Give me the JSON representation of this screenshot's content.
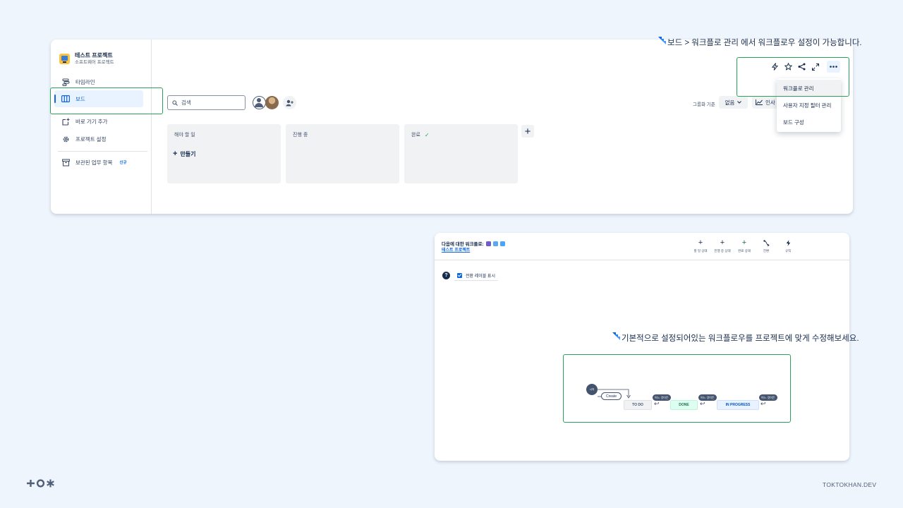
{
  "project": {
    "name": "테스트 프로젝트",
    "type": "소프트웨어 프로젝트"
  },
  "sidebar": {
    "items": [
      {
        "label": "타임라인",
        "icon": "timeline-icon"
      },
      {
        "label": "보드",
        "icon": "board-icon"
      },
      {
        "label": "바로 가기 추가",
        "icon": "add-shortcut-icon"
      },
      {
        "label": "프로젝트 설정",
        "icon": "gear-icon"
      },
      {
        "label": "보관된 업무 항목",
        "icon": "archive-icon",
        "badge": "신규"
      }
    ]
  },
  "board": {
    "search_placeholder": "검색",
    "group_by_label": "그룹화 기준",
    "group_by_value": "없음",
    "insights_label": "인사",
    "columns": [
      {
        "title": "해야 할 일",
        "create_label": "만들기"
      },
      {
        "title": "진행 중"
      },
      {
        "title": "완료",
        "done_check": "✓"
      }
    ]
  },
  "more_menu": {
    "items": [
      "워크플로 관리",
      "사용자 지정 필터 관리",
      "보드 구성"
    ]
  },
  "annotations": {
    "top": "보드 > 워크플로 관리 에서 워크플로우 설정이 가능합니다.",
    "bottom": "기본적으로 설정되어있는 워크플로우를 프로젝트에 맞게 수정해보세요."
  },
  "workflow": {
    "title": "다음에 대한 워크플로:",
    "project_link": "테스트 프로젝트",
    "tools": [
      "할 일 상태",
      "진행 중 상태",
      "완료 상태",
      "전환",
      "규칙"
    ],
    "show_labels": "전환 레이블 표시",
    "diagram": {
      "start": "시작",
      "create": "Create",
      "any": "어느 것이든",
      "statuses": [
        "TO DO",
        "DONE",
        "IN PROGRESS"
      ]
    }
  },
  "footer": {
    "logo": "+O*",
    "site": "TOKTOKHAN.DEV"
  },
  "colors": {
    "highlight": "#2aa15b",
    "brand": "#0c66e4",
    "background": "#eff5fd"
  }
}
